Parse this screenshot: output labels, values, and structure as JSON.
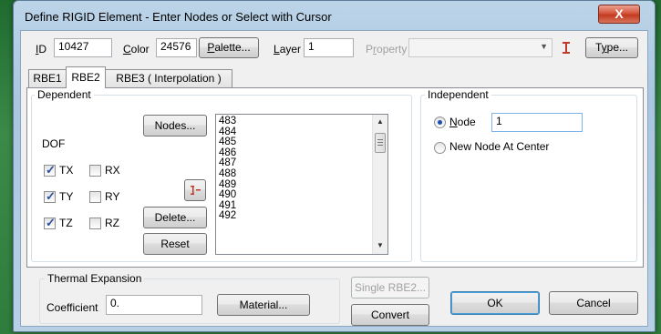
{
  "window": {
    "title": "Define RIGID Element - Enter Nodes or Select with Cursor",
    "close_glyph": "X"
  },
  "top": {
    "id_label_u": "I",
    "id_label_rest": "D",
    "id_value": "10427",
    "color_label_u": "C",
    "color_label_rest": "olor",
    "color_value": "24576",
    "palette_u": "P",
    "palette_rest": "alette...",
    "layer_label_u": "L",
    "layer_label_rest": "ayer",
    "layer_value": "1",
    "property_label_pre": "P",
    "property_label_u": "r",
    "property_label_rest": "operty",
    "property_value": "",
    "type_pre": "T",
    "type_u": "y",
    "type_rest": "pe..."
  },
  "tabs": [
    {
      "label": "RBE1",
      "active": false
    },
    {
      "label": "RBE2",
      "active": true
    },
    {
      "label": "RBE3 ( Interpolation )",
      "active": false
    }
  ],
  "dependent": {
    "group_label": "Dependent",
    "dof_label": "DOF",
    "checkboxes": [
      {
        "label": "TX",
        "checked": true
      },
      {
        "label": "RX",
        "checked": false
      },
      {
        "label": "TY",
        "checked": true
      },
      {
        "label": "RY",
        "checked": false
      },
      {
        "label": "TZ",
        "checked": true
      },
      {
        "label": "RZ",
        "checked": false
      }
    ],
    "nodes_button": "Nodes...",
    "delete_button": "Delete...",
    "reset_button": "Reset",
    "node_list": [
      "483",
      "484",
      "485",
      "486",
      "487",
      "488",
      "489",
      "490",
      "491",
      "492"
    ]
  },
  "independent": {
    "group_label": "Independent",
    "node_radio_u": "N",
    "node_radio_rest": "ode",
    "node_selected": true,
    "node_value": "1",
    "new_node_label": "New Node At Center",
    "new_node_selected": false
  },
  "thermal": {
    "group_label": "Thermal Expansion",
    "coefficient_label": "Coefficient",
    "coefficient_value": "0.",
    "material_button": "Material..."
  },
  "actions": {
    "single_rbe2": "Single RBE2...",
    "convert": "Convert",
    "ok": "OK",
    "cancel": "Cancel"
  },
  "colors": {
    "accent": "#1a4fb0",
    "window_frame": "#a9c6df",
    "close_red": "#c23a1f"
  }
}
